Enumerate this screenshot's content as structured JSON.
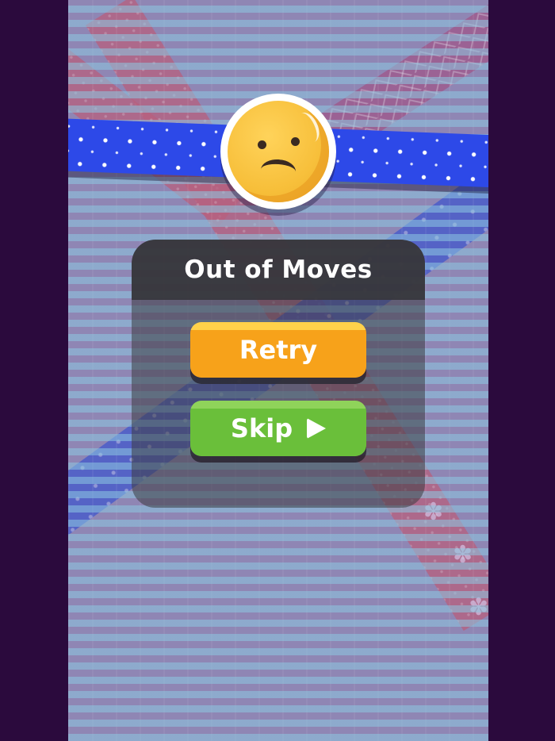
{
  "dialog": {
    "title": "Out of Moves",
    "retry_label": "Retry",
    "skip_label": "Skip"
  },
  "icons": {
    "face": "sad-face-icon",
    "skip": "play-icon"
  },
  "colors": {
    "outer_background": "#2b0a3d",
    "retry_button": "#f7a21a",
    "skip_button": "#6abf3a",
    "front_ribbon": "#2d49e8",
    "face": "#f7bf3a"
  }
}
